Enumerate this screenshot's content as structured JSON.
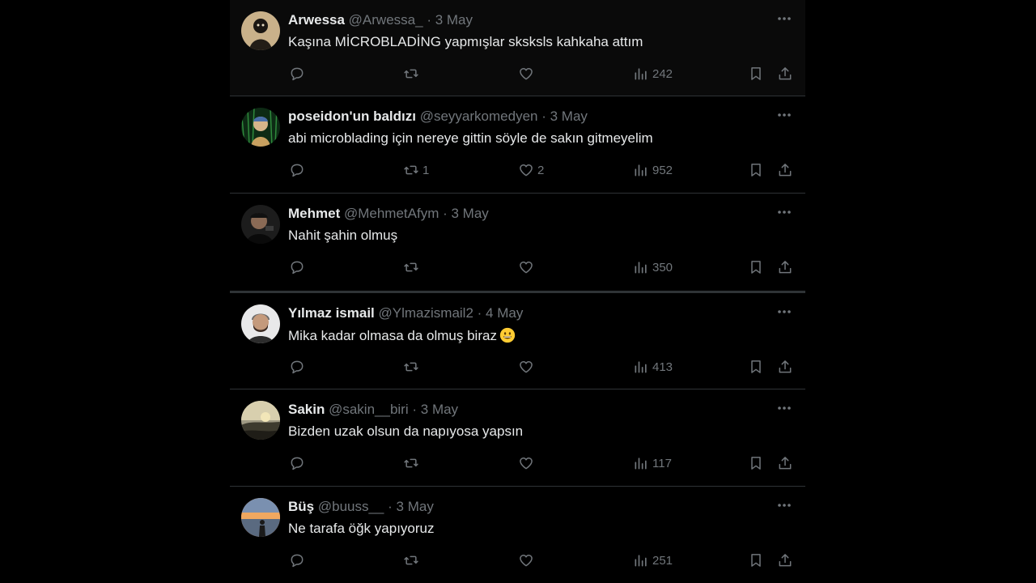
{
  "colors": {
    "background": "#000000",
    "text_primary": "#e7e9ea",
    "text_secondary": "#71767b",
    "divider": "#2f3336"
  },
  "icons": {
    "more": "more-horizontal-icon",
    "reply": "reply-icon",
    "retweet": "retweet-icon",
    "like": "heart-icon",
    "views": "views-chart-icon",
    "bookmark": "bookmark-icon",
    "share": "share-icon"
  },
  "tweets": [
    {
      "name": "Arwessa",
      "handle": "@Arwessa_",
      "sep": "·",
      "date": "3 May",
      "text": "Kaşına MİCROBLADİNG yapmışlar sksksls kahkaha attım",
      "replies": "",
      "retweets": "",
      "likes": "",
      "views": "242",
      "avatar": "dark-figure"
    },
    {
      "name": "poseidon'un baldızı",
      "handle": "@seyyarkomedyen",
      "sep": "·",
      "date": "3 May",
      "text": "abi microblading için nereye gittin söyle de sakın gitmeyelim",
      "replies": "",
      "retweets": "1",
      "likes": "2",
      "views": "952",
      "avatar": "painting-green"
    },
    {
      "name": "Mehmet",
      "handle": "@MehmetAfym",
      "sep": "·",
      "date": "3 May",
      "text": "Nahit şahin olmuş",
      "replies": "",
      "retweets": "",
      "likes": "",
      "views": "350",
      "avatar": "dark-portrait"
    },
    {
      "name": "Yılmaz ismail",
      "handle": "@Ylmazismail2",
      "sep": "·",
      "date": "4 May",
      "text": "Mika kadar olmasa da olmuş biraz",
      "emoji": "grinning-face-emoji",
      "replies": "",
      "retweets": "",
      "likes": "",
      "views": "413",
      "avatar": "man-beard"
    },
    {
      "name": "Sakin",
      "handle": "@sakin__biri",
      "sep": "·",
      "date": "3 May",
      "text": "Bizden uzak olsun da napıyosa yapsın",
      "replies": "",
      "retweets": "",
      "likes": "",
      "views": "117",
      "avatar": "sunset-landscape"
    },
    {
      "name": "Büş",
      "handle": "@buuss__",
      "sep": "·",
      "date": "3 May",
      "text": "Ne tarafa öğk yapıyoruz",
      "replies": "",
      "retweets": "",
      "likes": "",
      "views": "251",
      "avatar": "sea-sunset"
    }
  ]
}
